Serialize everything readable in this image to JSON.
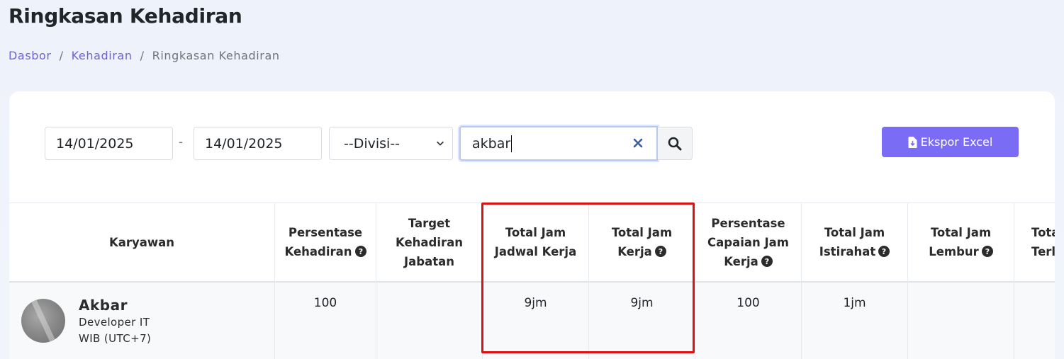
{
  "page": {
    "title": "Ringkasan Kehadiran",
    "breadcrumb": [
      "Dasbor",
      "Kehadiran",
      "Ringkasan Kehadiran"
    ]
  },
  "filters": {
    "date_start": "14/01/2025",
    "date_separator": "-",
    "date_end": "14/01/2025",
    "division": "--Divisi--",
    "search_value": "akbar",
    "export_label": "Ekspor Excel"
  },
  "table": {
    "columns": [
      {
        "label": "Karyawan",
        "help": false
      },
      {
        "label": "Persentase Kehadiran",
        "help": true
      },
      {
        "label": "Target Kehadiran Jabatan",
        "help": false
      },
      {
        "label": "Total Jam Jadwal Kerja",
        "help": false
      },
      {
        "label": "Total Jam Kerja",
        "help": true
      },
      {
        "label": "Persentase Capaian Jam Kerja",
        "help": true
      },
      {
        "label": "Total Jam Istirahat",
        "help": true
      },
      {
        "label": "Total Jam Lembur",
        "help": true
      },
      {
        "label": "Total Terla",
        "help": false
      }
    ],
    "rows": [
      {
        "employee": {
          "name": "Akbar",
          "position": "Developer IT",
          "timezone": "WIB (UTC+7)"
        },
        "values": [
          "100",
          "",
          "9jm",
          "9jm",
          "100",
          "1jm",
          "",
          ""
        ]
      }
    ]
  },
  "colors": {
    "accent": "#7b6cf6",
    "link": "#6f63d9",
    "highlight": "#e01010"
  }
}
